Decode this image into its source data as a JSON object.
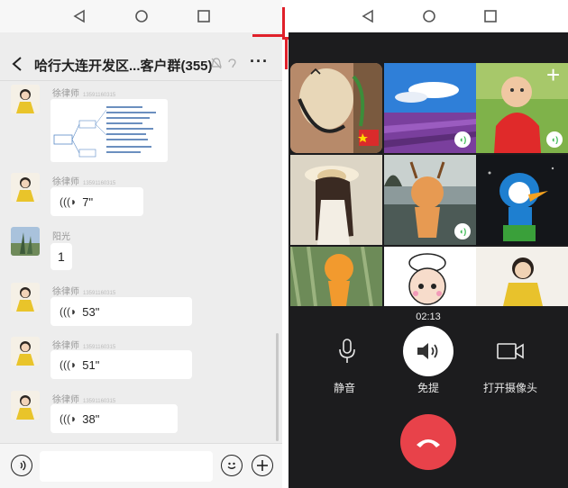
{
  "left": {
    "title": "哈行大连开发区...客户群(355)",
    "menu_label": "···",
    "messages": [
      {
        "sender": "徐律师",
        "phone": "13591160315",
        "type": "image"
      },
      {
        "sender": "徐律师",
        "phone": "13591160315",
        "type": "voice",
        "duration": "7\""
      },
      {
        "sender": "阳光",
        "phone": "",
        "type": "text",
        "text": "1"
      },
      {
        "sender": "徐律师",
        "phone": "13591160315",
        "type": "voice",
        "duration": "53\""
      },
      {
        "sender": "徐律师",
        "phone": "13591160315",
        "type": "voice",
        "duration": "51\""
      },
      {
        "sender": "徐律师",
        "phone": "13591160315",
        "type": "voice",
        "duration": "38\""
      }
    ]
  },
  "right": {
    "timer": "02:13",
    "controls": {
      "mute_label": "静音",
      "speaker_label": "免提",
      "camera_label": "打开摄像头"
    },
    "add_label": "+"
  },
  "colors": {
    "accent_red": "#e0202a",
    "hangup_red": "#e8424a",
    "mic_green": "#3cba54"
  }
}
